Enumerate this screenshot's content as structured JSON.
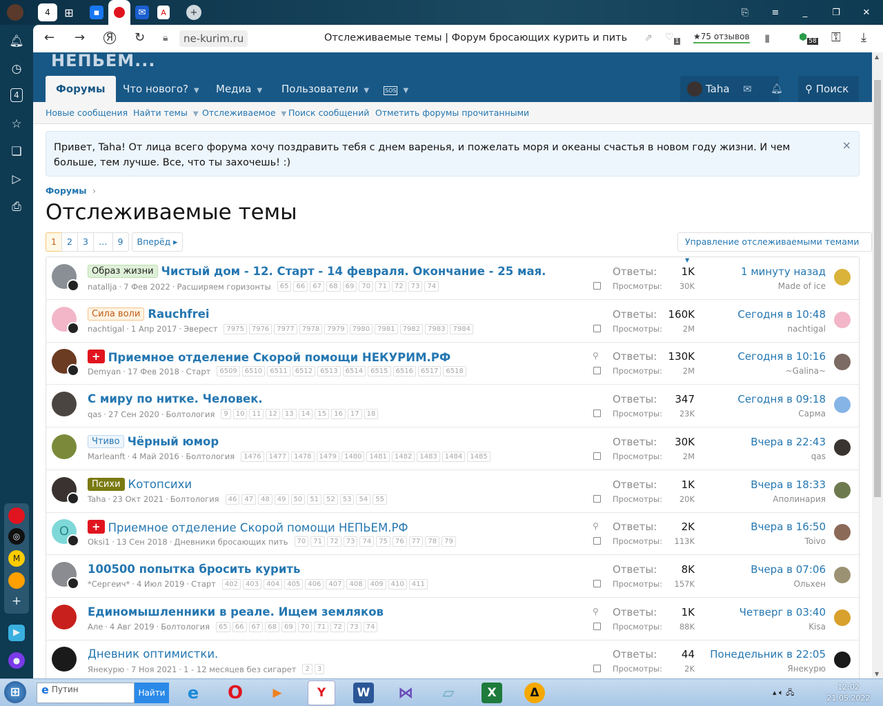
{
  "browser": {
    "tab_count": "4",
    "url": "ne-kurim.ru",
    "page_title": "Отслеживаемые темы | Форум бросающих курить и пить",
    "reviews": "★75 отзывов",
    "badge_1": "1",
    "badge_58": "58",
    "sidebar_count": "4"
  },
  "site": {
    "logo": "НЕПЬЕМ...",
    "nav": [
      "Форумы",
      "Что нового?",
      "Медиа",
      "Пользователи"
    ],
    "user": "Taha",
    "search": "Поиск",
    "subnav": [
      "Новые сообщения",
      "Найти темы",
      "Отслеживаемое",
      "Поиск сообщений",
      "Отметить форумы прочитанными"
    ]
  },
  "notice": {
    "text": "Привет, Taha! От лица всего форума хочу поздравить тебя с днем варенья, и пожелать моря и океаны счастья в новом году жизни. И чем больше, тем лучше. Все, что ты захочешь! :)",
    "close": "×"
  },
  "breadcrumb": "Форумы",
  "title": "Отслеживаемые темы",
  "pagination": {
    "pages": [
      "1",
      "2",
      "3",
      "…",
      "9"
    ],
    "next": "Вперёд ▸",
    "current": "1"
  },
  "manage": "Управление отслеживаемыми темами ▾",
  "labels": {
    "replies": "Ответы:",
    "views": "Просмотры:"
  },
  "threads": [
    {
      "label": "Образ жизни",
      "label_bg": "#dff0d8",
      "label_fg": "#222",
      "label_border": "#b9dfae",
      "title": "Чистый дом - 12. Старт - 14 февраля. Окончание - 25 мая.",
      "bold": true,
      "author": "natallja",
      "date": "7 Фев 2022",
      "forum": "Расширяем горизонты",
      "pages": [
        "65",
        "66",
        "67",
        "68",
        "69",
        "70",
        "71",
        "72",
        "73",
        "74"
      ],
      "pinned": false,
      "replies": "1K",
      "views": "30K",
      "last_time": "1 минуту назад",
      "last_user": "Made of ice",
      "avatar": "#8a8f96",
      "last_avatar": "#d9b33a"
    },
    {
      "label": "Сила воли",
      "label_bg": "#fef3e2",
      "label_fg": "#c05c1a",
      "label_border": "#f3c58d",
      "title": "Rauchfrei",
      "bold": true,
      "author": "nachtigal",
      "date": "1 Апр 2017",
      "forum": "Эверест",
      "pages": [
        "7975",
        "7976",
        "7977",
        "7978",
        "7979",
        "7980",
        "7981",
        "7982",
        "7983",
        "7984"
      ],
      "pinned": false,
      "replies": "160K",
      "views": "2M",
      "last_time": "Сегодня в 10:48",
      "last_user": "nachtigal",
      "avatar": "#f2b6c8",
      "last_avatar": "#f2b6c8"
    },
    {
      "label": "+",
      "label_bg": "#e0141e",
      "label_fg": "#fff",
      "label_border": "#e0141e",
      "title": "Приемное отделение Скорой помощи НЕКУРИМ.РФ",
      "bold": true,
      "author": "Demyan",
      "date": "17 Фев 2018",
      "forum": "Старт",
      "pages": [
        "6509",
        "6510",
        "6511",
        "6512",
        "6513",
        "6514",
        "6515",
        "6516",
        "6517",
        "6518"
      ],
      "pinned": true,
      "replies": "130K",
      "views": "2M",
      "last_time": "Сегодня в 10:16",
      "last_user": "~Galina~",
      "avatar": "#6b3b22",
      "last_avatar": "#7c6a64"
    },
    {
      "label": "",
      "title": "С миру по нитке. Человек.",
      "bold": true,
      "author": "qas",
      "date": "27 Сен 2020",
      "forum": "Болтология",
      "pages": [
        "9",
        "10",
        "11",
        "12",
        "13",
        "14",
        "15",
        "16",
        "17",
        "18"
      ],
      "pinned": false,
      "replies": "347",
      "views": "23K",
      "last_time": "Сегодня в 09:18",
      "last_user": "Сарма",
      "avatar": "#4a4540",
      "last_avatar": "#86b4e6"
    },
    {
      "label": "Чтиво",
      "label_bg": "#eef5fc",
      "label_fg": "#2577b1",
      "label_border": "#bcd6ee",
      "title": "Чёрный юмор",
      "bold": true,
      "author": "Marleanft",
      "date": "4 Май 2016",
      "forum": "Болтология",
      "pages": [
        "1476",
        "1477",
        "1478",
        "1479",
        "1480",
        "1481",
        "1482",
        "1483",
        "1484",
        "1485"
      ],
      "pinned": false,
      "replies": "30K",
      "views": "2M",
      "last_time": "Вчера в 22:43",
      "last_user": "qas",
      "avatar": "#7a8a3a",
      "last_avatar": "#3a3430"
    },
    {
      "label": "Психи",
      "label_bg": "#7a7a12",
      "label_fg": "#fff",
      "label_border": "#7a7a12",
      "title": "Котопсихи",
      "bold": false,
      "author": "Taha",
      "date": "23 Окт 2021",
      "forum": "Болтология",
      "pages": [
        "46",
        "47",
        "48",
        "49",
        "50",
        "51",
        "52",
        "53",
        "54",
        "55"
      ],
      "pinned": false,
      "replies": "1K",
      "views": "20K",
      "last_time": "Вчера в 18:33",
      "last_user": "Аполинария",
      "avatar": "#3a3230",
      "last_avatar": "#6d7a50"
    },
    {
      "label": "+",
      "label_bg": "#e0141e",
      "label_fg": "#fff",
      "label_border": "#e0141e",
      "title": "Приемное отделение Скорой помощи НЕПЬЕМ.РФ",
      "bold": false,
      "author": "Oksi1",
      "date": "13 Сен 2018",
      "forum": "Дневники бросающих пить",
      "pages": [
        "70",
        "71",
        "72",
        "73",
        "74",
        "75",
        "76",
        "77",
        "78",
        "79"
      ],
      "pinned": true,
      "replies": "2K",
      "views": "113K",
      "last_time": "Вчера в 16:50",
      "last_user": "Toivo",
      "avatar": "#7fd8d8",
      "avatar_letter": "O",
      "last_avatar": "#8b6a58"
    },
    {
      "label": "",
      "title": "100500 попытка бросить курить",
      "bold": true,
      "author": "*Сергеич*",
      "date": "4 Июл 2019",
      "forum": "Старт",
      "pages": [
        "402",
        "403",
        "404",
        "405",
        "406",
        "407",
        "408",
        "409",
        "410",
        "411"
      ],
      "pinned": false,
      "replies": "8K",
      "views": "157K",
      "last_time": "Вчера в 07:06",
      "last_user": "Ольхен",
      "avatar": "#8a8c92",
      "last_avatar": "#9a9272"
    },
    {
      "label": "",
      "title": "Единомышленники в реале. Ищем земляков",
      "bold": true,
      "author": "Але",
      "date": "4 Авг 2019",
      "forum": "Болтология",
      "pages": [
        "65",
        "66",
        "67",
        "68",
        "69",
        "70",
        "71",
        "72",
        "73",
        "74"
      ],
      "pinned": true,
      "replies": "1K",
      "views": "88K",
      "last_time": "Четверг в 03:40",
      "last_user": "Kisa",
      "avatar": "#c8201c",
      "last_avatar": "#d8a02c"
    },
    {
      "label": "",
      "title": "Дневник оптимистки.",
      "bold": false,
      "author": "Янекурю",
      "date": "7 Ноя 2021",
      "forum": "1 - 12 месяцев без сигарет",
      "pages": [
        "2",
        "3"
      ],
      "pinned": false,
      "replies": "44",
      "views": "2K",
      "last_time": "Понедельник в 22:05",
      "last_user": "Янекурю",
      "avatar": "#1a1a1a",
      "last_avatar": "#1a1a1a"
    }
  ],
  "taskbar": {
    "search_value": "Путин",
    "search_button": "Найти",
    "time": "12:02",
    "date": "21.05.2022"
  }
}
